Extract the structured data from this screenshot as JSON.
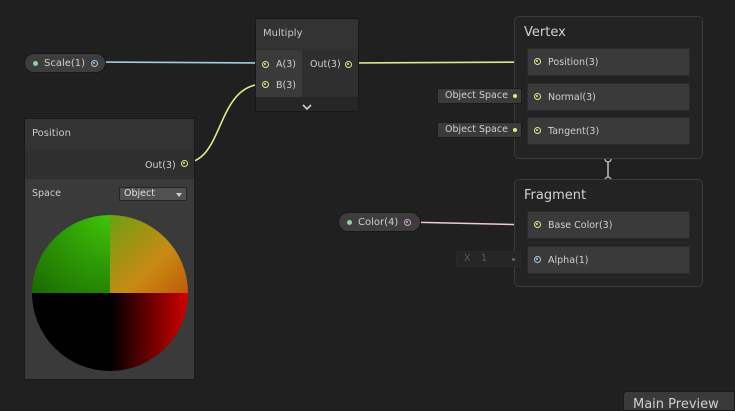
{
  "properties": {
    "scale": {
      "label": "Scale(1)",
      "color": "#9ecfe4"
    },
    "color": {
      "label": "Color(4)",
      "color": "#d8a0c8"
    }
  },
  "multiply": {
    "title": "Multiply",
    "inputs": [
      "A(3)",
      "B(3)"
    ],
    "output": "Out(3)",
    "expand_icon": "chevron-down-icon"
  },
  "position": {
    "title": "Position",
    "output": "Out(3)",
    "space_label": "Space",
    "space_value": "Object",
    "preview_colors": [
      "#5aaa10",
      "#b07a10",
      "#000000",
      "#c00000"
    ]
  },
  "vertex": {
    "title": "Vertex",
    "blocks": [
      "Position(3)",
      "Normal(3)",
      "Tangent(3)"
    ],
    "normal_default": "Object Space",
    "tangent_default": "Object Space"
  },
  "fragment": {
    "title": "Fragment",
    "blocks": [
      "Base Color(3)",
      "Alpha(1)"
    ],
    "alpha_x_label": "X",
    "alpha_value": "1"
  },
  "corner_panel": {
    "label": "Main Preview"
  },
  "colors": {
    "wire_vector3": "#e1ea8a",
    "wire_float": "#9ecfe4",
    "wire_vector4": "#f0c8dc"
  }
}
